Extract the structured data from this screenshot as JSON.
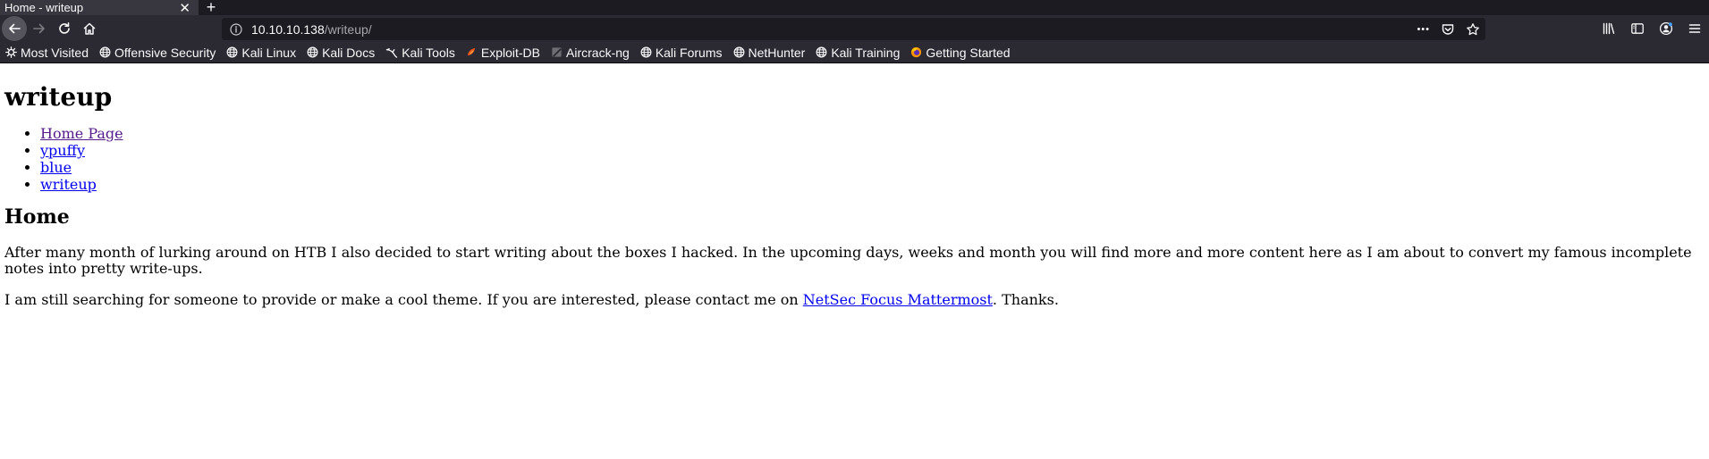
{
  "browser": {
    "tab_title": "Home - writeup",
    "tab_close": "✕",
    "new_tab": "+",
    "url_host": "10.10.10.138",
    "url_path": "/writeup/",
    "url_actions": "•••"
  },
  "bookmarks": [
    {
      "label": "Most Visited",
      "icon": "gear-icon"
    },
    {
      "label": "Offensive Security",
      "icon": "globe-icon"
    },
    {
      "label": "Kali Linux",
      "icon": "globe-icon"
    },
    {
      "label": "Kali Docs",
      "icon": "globe-icon"
    },
    {
      "label": "Kali Tools",
      "icon": "kali-dragon-icon"
    },
    {
      "label": "Exploit-DB",
      "icon": "exploit-db-icon"
    },
    {
      "label": "Aircrack-ng",
      "icon": "aircrack-icon"
    },
    {
      "label": "Kali Forums",
      "icon": "globe-icon"
    },
    {
      "label": "NetHunter",
      "icon": "globe-icon"
    },
    {
      "label": "Kali Training",
      "icon": "globe-icon"
    },
    {
      "label": "Getting Started",
      "icon": "firefox-icon"
    }
  ],
  "page": {
    "title": "writeup",
    "nav": [
      {
        "label": "Home Page",
        "visited": true
      },
      {
        "label": "ypuffy",
        "visited": false
      },
      {
        "label": "blue",
        "visited": false
      },
      {
        "label": "writeup",
        "visited": false
      }
    ],
    "heading": "Home",
    "para1": "After many month of lurking around on HTB I also decided to start writing about the boxes I hacked. In the upcoming days, weeks and month you will find more and more content here as I am about to convert my famous incomplete notes into pretty write-ups.",
    "para2_before": "I am still searching for someone to provide or make a cool theme. If you are interested, please contact me on ",
    "para2_link": "NetSec Focus Mattermost",
    "para2_after": ". Thanks."
  },
  "colors": {
    "tabbar_bg": "#1c1b22",
    "toolbar_bg": "#2b2a33",
    "link": "#0000ee",
    "visited_link": "#551a8b"
  }
}
